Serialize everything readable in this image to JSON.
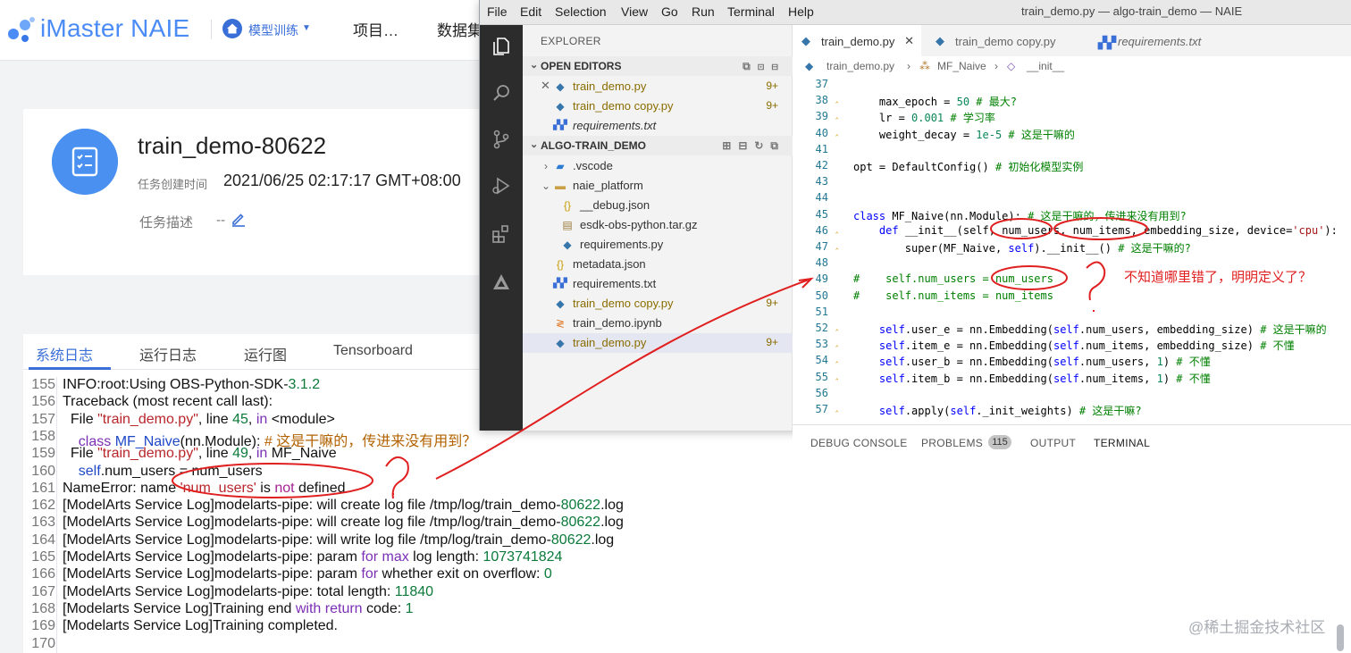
{
  "webapp": {
    "brand": "iMaster NAIE",
    "nav": {
      "module": "模型训练",
      "project": "项目…",
      "data": "数据集"
    },
    "task": {
      "title": "train_demo-80622",
      "created_label": "任务创建时间",
      "created_value": "2021/06/25 02:17:17 GMT+08:00",
      "desc_label": "任务描述",
      "desc_value": "--"
    },
    "log_tabs": [
      "系统日志",
      "运行日志",
      "运行图",
      "Tensorboard"
    ],
    "log_lines": [
      {
        "n": "155",
        "parts": [
          {
            "t": "INFO:root:Using OBS-Python-SDK-"
          },
          {
            "t": "3.1.2",
            "c": "lg-green"
          }
        ]
      },
      {
        "n": "156",
        "parts": [
          {
            "t": "Traceback (most recent call last):"
          }
        ]
      },
      {
        "n": "157",
        "parts": [
          {
            "t": "  File "
          },
          {
            "t": "\"train_demo.py\"",
            "c": "lg-red"
          },
          {
            "t": ", line "
          },
          {
            "t": "45",
            "c": "lg-green"
          },
          {
            "t": ", "
          },
          {
            "t": "in",
            "c": "lg-purple"
          },
          {
            "t": " <module>"
          }
        ]
      },
      {
        "n": "158",
        "parts": [
          {
            "t": "    "
          },
          {
            "t": "class",
            "c": "lg-purple"
          },
          {
            "t": " "
          },
          {
            "t": "MF_Naive",
            "c": "lg-blue"
          },
          {
            "t": "(nn.Module): "
          },
          {
            "t": "# 这是干嘛的，传进来没有用到？",
            "c": "lg-orange"
          }
        ]
      },
      {
        "n": "159",
        "parts": [
          {
            "t": "  File "
          },
          {
            "t": "\"train_demo.py\"",
            "c": "lg-red"
          },
          {
            "t": ", line "
          },
          {
            "t": "49",
            "c": "lg-green"
          },
          {
            "t": ", "
          },
          {
            "t": "in",
            "c": "lg-purple"
          },
          {
            "t": " MF_Naive"
          }
        ]
      },
      {
        "n": "160",
        "parts": [
          {
            "t": "    "
          },
          {
            "t": "self",
            "c": "lg-blue"
          },
          {
            "t": ".num_users = num_users"
          }
        ]
      },
      {
        "n": "161",
        "parts": [
          {
            "t": "NameError: name "
          },
          {
            "t": "'num_users'",
            "c": "lg-red"
          },
          {
            "t": " is "
          },
          {
            "t": "not",
            "c": "lg-magenta"
          },
          {
            "t": " defined"
          }
        ]
      },
      {
        "n": "162",
        "parts": [
          {
            "t": "[ModelArts Service Log]modelarts-pipe: will create log file /tmp/log/train_demo-"
          },
          {
            "t": "80622",
            "c": "lg-green"
          },
          {
            "t": ".log"
          }
        ]
      },
      {
        "n": "163",
        "parts": [
          {
            "t": "[ModelArts Service Log]modelarts-pipe: will create log file /tmp/log/train_demo-"
          },
          {
            "t": "80622",
            "c": "lg-green"
          },
          {
            "t": ".log"
          }
        ]
      },
      {
        "n": "164",
        "parts": [
          {
            "t": "[ModelArts Service Log]modelarts-pipe: will write log file /tmp/log/train_demo-"
          },
          {
            "t": "80622",
            "c": "lg-green"
          },
          {
            "t": ".log"
          }
        ]
      },
      {
        "n": "165",
        "parts": [
          {
            "t": "[ModelArts Service Log]modelarts-pipe: param "
          },
          {
            "t": "for",
            "c": "lg-purple"
          },
          {
            "t": " "
          },
          {
            "t": "max",
            "c": "lg-purple"
          },
          {
            "t": " log length: "
          },
          {
            "t": "1073741824",
            "c": "lg-green"
          }
        ]
      },
      {
        "n": "166",
        "parts": [
          {
            "t": "[ModelArts Service Log]modelarts-pipe: param "
          },
          {
            "t": "for",
            "c": "lg-purple"
          },
          {
            "t": " whether exit on overflow: "
          },
          {
            "t": "0",
            "c": "lg-green"
          }
        ]
      },
      {
        "n": "167",
        "parts": [
          {
            "t": "[ModelArts Service Log]modelarts-pipe: total length: "
          },
          {
            "t": "11840",
            "c": "lg-green"
          }
        ]
      },
      {
        "n": "168",
        "parts": [
          {
            "t": "[Modelarts Service Log]Training end "
          },
          {
            "t": "with",
            "c": "lg-purple"
          },
          {
            "t": " "
          },
          {
            "t": "return",
            "c": "lg-purple"
          },
          {
            "t": " code: "
          },
          {
            "t": "1",
            "c": "lg-green"
          }
        ]
      },
      {
        "n": "169",
        "parts": [
          {
            "t": "[Modelarts Service Log]Training completed."
          }
        ]
      },
      {
        "n": "170",
        "parts": []
      }
    ],
    "watermark": "@稀土掘金技术社区"
  },
  "vscode": {
    "menu": [
      "File",
      "Edit",
      "Selection",
      "View",
      "Go",
      "Run",
      "Terminal",
      "Help"
    ],
    "window_title": "train_demo.py — algo-train_demo — NAIE",
    "sidebar": {
      "title": "EXPLORER",
      "open_editors_label": "OPEN EDITORS",
      "project_label": "ALGO-TRAIN_DEMO",
      "open_editors": [
        {
          "label": "train_demo.py",
          "badge": "9+"
        },
        {
          "label": "train_demo copy.py",
          "badge": "9+"
        },
        {
          "label": "requirements.txt",
          "badge": ""
        }
      ],
      "tree": [
        {
          "label": ".vscode",
          "badge": ""
        },
        {
          "label": "naie_platform",
          "badge": ""
        },
        {
          "label": "__debug.json",
          "badge": ""
        },
        {
          "label": "esdk-obs-python.tar.gz",
          "badge": ""
        },
        {
          "label": "requirements.py",
          "badge": ""
        },
        {
          "label": "metadata.json",
          "badge": ""
        },
        {
          "label": "requirements.txt",
          "badge": ""
        },
        {
          "label": "train_demo copy.py",
          "badge": "9+"
        },
        {
          "label": "train_demo.ipynb",
          "badge": ""
        },
        {
          "label": "train_demo.py",
          "badge": "9+"
        }
      ]
    },
    "tabs": [
      {
        "label": "train_demo.py",
        "close": "✕"
      },
      {
        "label": "train_demo copy.py"
      },
      {
        "label": "requirements.txt"
      }
    ],
    "breadcrumb": [
      "train_demo.py",
      "MF_Naive",
      "__init__"
    ],
    "code": [
      {
        "n": "37",
        "h": ""
      },
      {
        "n": "38",
        "h": "    max_epoch = <span class=\"num\">50</span> <span class=\"cm\"># 最大?</span>",
        "mark": true
      },
      {
        "n": "39",
        "h": "    lr = <span class=\"num\">0.001</span> <span class=\"cm\"># 学习率</span>",
        "mark": true
      },
      {
        "n": "40",
        "h": "    weight_decay = <span class=\"num\">1e-5</span> <span class=\"cm\"># 这是干嘛的</span>",
        "mark": true
      },
      {
        "n": "41",
        "h": ""
      },
      {
        "n": "42",
        "h": "opt = DefaultConfig() <span class=\"cm\"># 初始化模型实例</span>"
      },
      {
        "n": "43",
        "h": ""
      },
      {
        "n": "44",
        "h": ""
      },
      {
        "n": "45",
        "h": "<span class=\"kw\">class</span> MF_Naive(nn.Module): <span class=\"cm\"># 这是干嘛的，传进来没有用到?</span>"
      },
      {
        "n": "46",
        "h": "    <span class=\"kw\">def</span> __init__(self, num_users, num_items, embedding_size, device=<span class=\"str\">'cpu'</span>):",
        "mark": true
      },
      {
        "n": "47",
        "h": "        super(MF_Naive, <span class=\"slf\">self</span>).__init__() <span class=\"cm\"># 这是干嘛的?</span>",
        "mark": true
      },
      {
        "n": "48",
        "h": ""
      },
      {
        "n": "49",
        "h": "<span class=\"cm\">#    self.num_users = num_users</span>"
      },
      {
        "n": "50",
        "h": "<span class=\"cm\">#    self.num_items = num_items</span>"
      },
      {
        "n": "51",
        "h": ""
      },
      {
        "n": "52",
        "h": "    <span class=\"slf\">self</span>.user_e = nn.Embedding(<span class=\"slf\">self</span>.num_users, embedding_size) <span class=\"cm\"># 这是干嘛的</span>",
        "mark": true
      },
      {
        "n": "53",
        "h": "    <span class=\"slf\">self</span>.item_e = nn.Embedding(<span class=\"slf\">self</span>.num_items, embedding_size) <span class=\"cm\"># 不懂</span>",
        "mark": true
      },
      {
        "n": "54",
        "h": "    <span class=\"slf\">self</span>.user_b = nn.Embedding(<span class=\"slf\">self</span>.num_users, <span class=\"num\">1</span>) <span class=\"cm\"># 不懂</span>",
        "mark": true
      },
      {
        "n": "55",
        "h": "    <span class=\"slf\">self</span>.item_b = nn.Embedding(<span class=\"slf\">self</span>.num_items, <span class=\"num\">1</span>) <span class=\"cm\"># 不懂</span>",
        "mark": true
      },
      {
        "n": "56",
        "h": ""
      },
      {
        "n": "57",
        "h": "    <span class=\"slf\">self</span>.apply(<span class=\"slf\">self</span>._init_weights) <span class=\"cm\"># 这是干嘛?</span>",
        "mark": true
      }
    ],
    "panel": {
      "debug_console": "DEBUG CONSOLE",
      "problems": "PROBLEMS",
      "problems_count": "115",
      "output": "OUTPUT",
      "terminal": "TERMINAL"
    }
  },
  "annotation_note": "不知道哪里错了，明明定义了？",
  "colors": {
    "brand": "#4a8bf5",
    "accent": "#3a6fd8",
    "annotation": "#e02020"
  }
}
